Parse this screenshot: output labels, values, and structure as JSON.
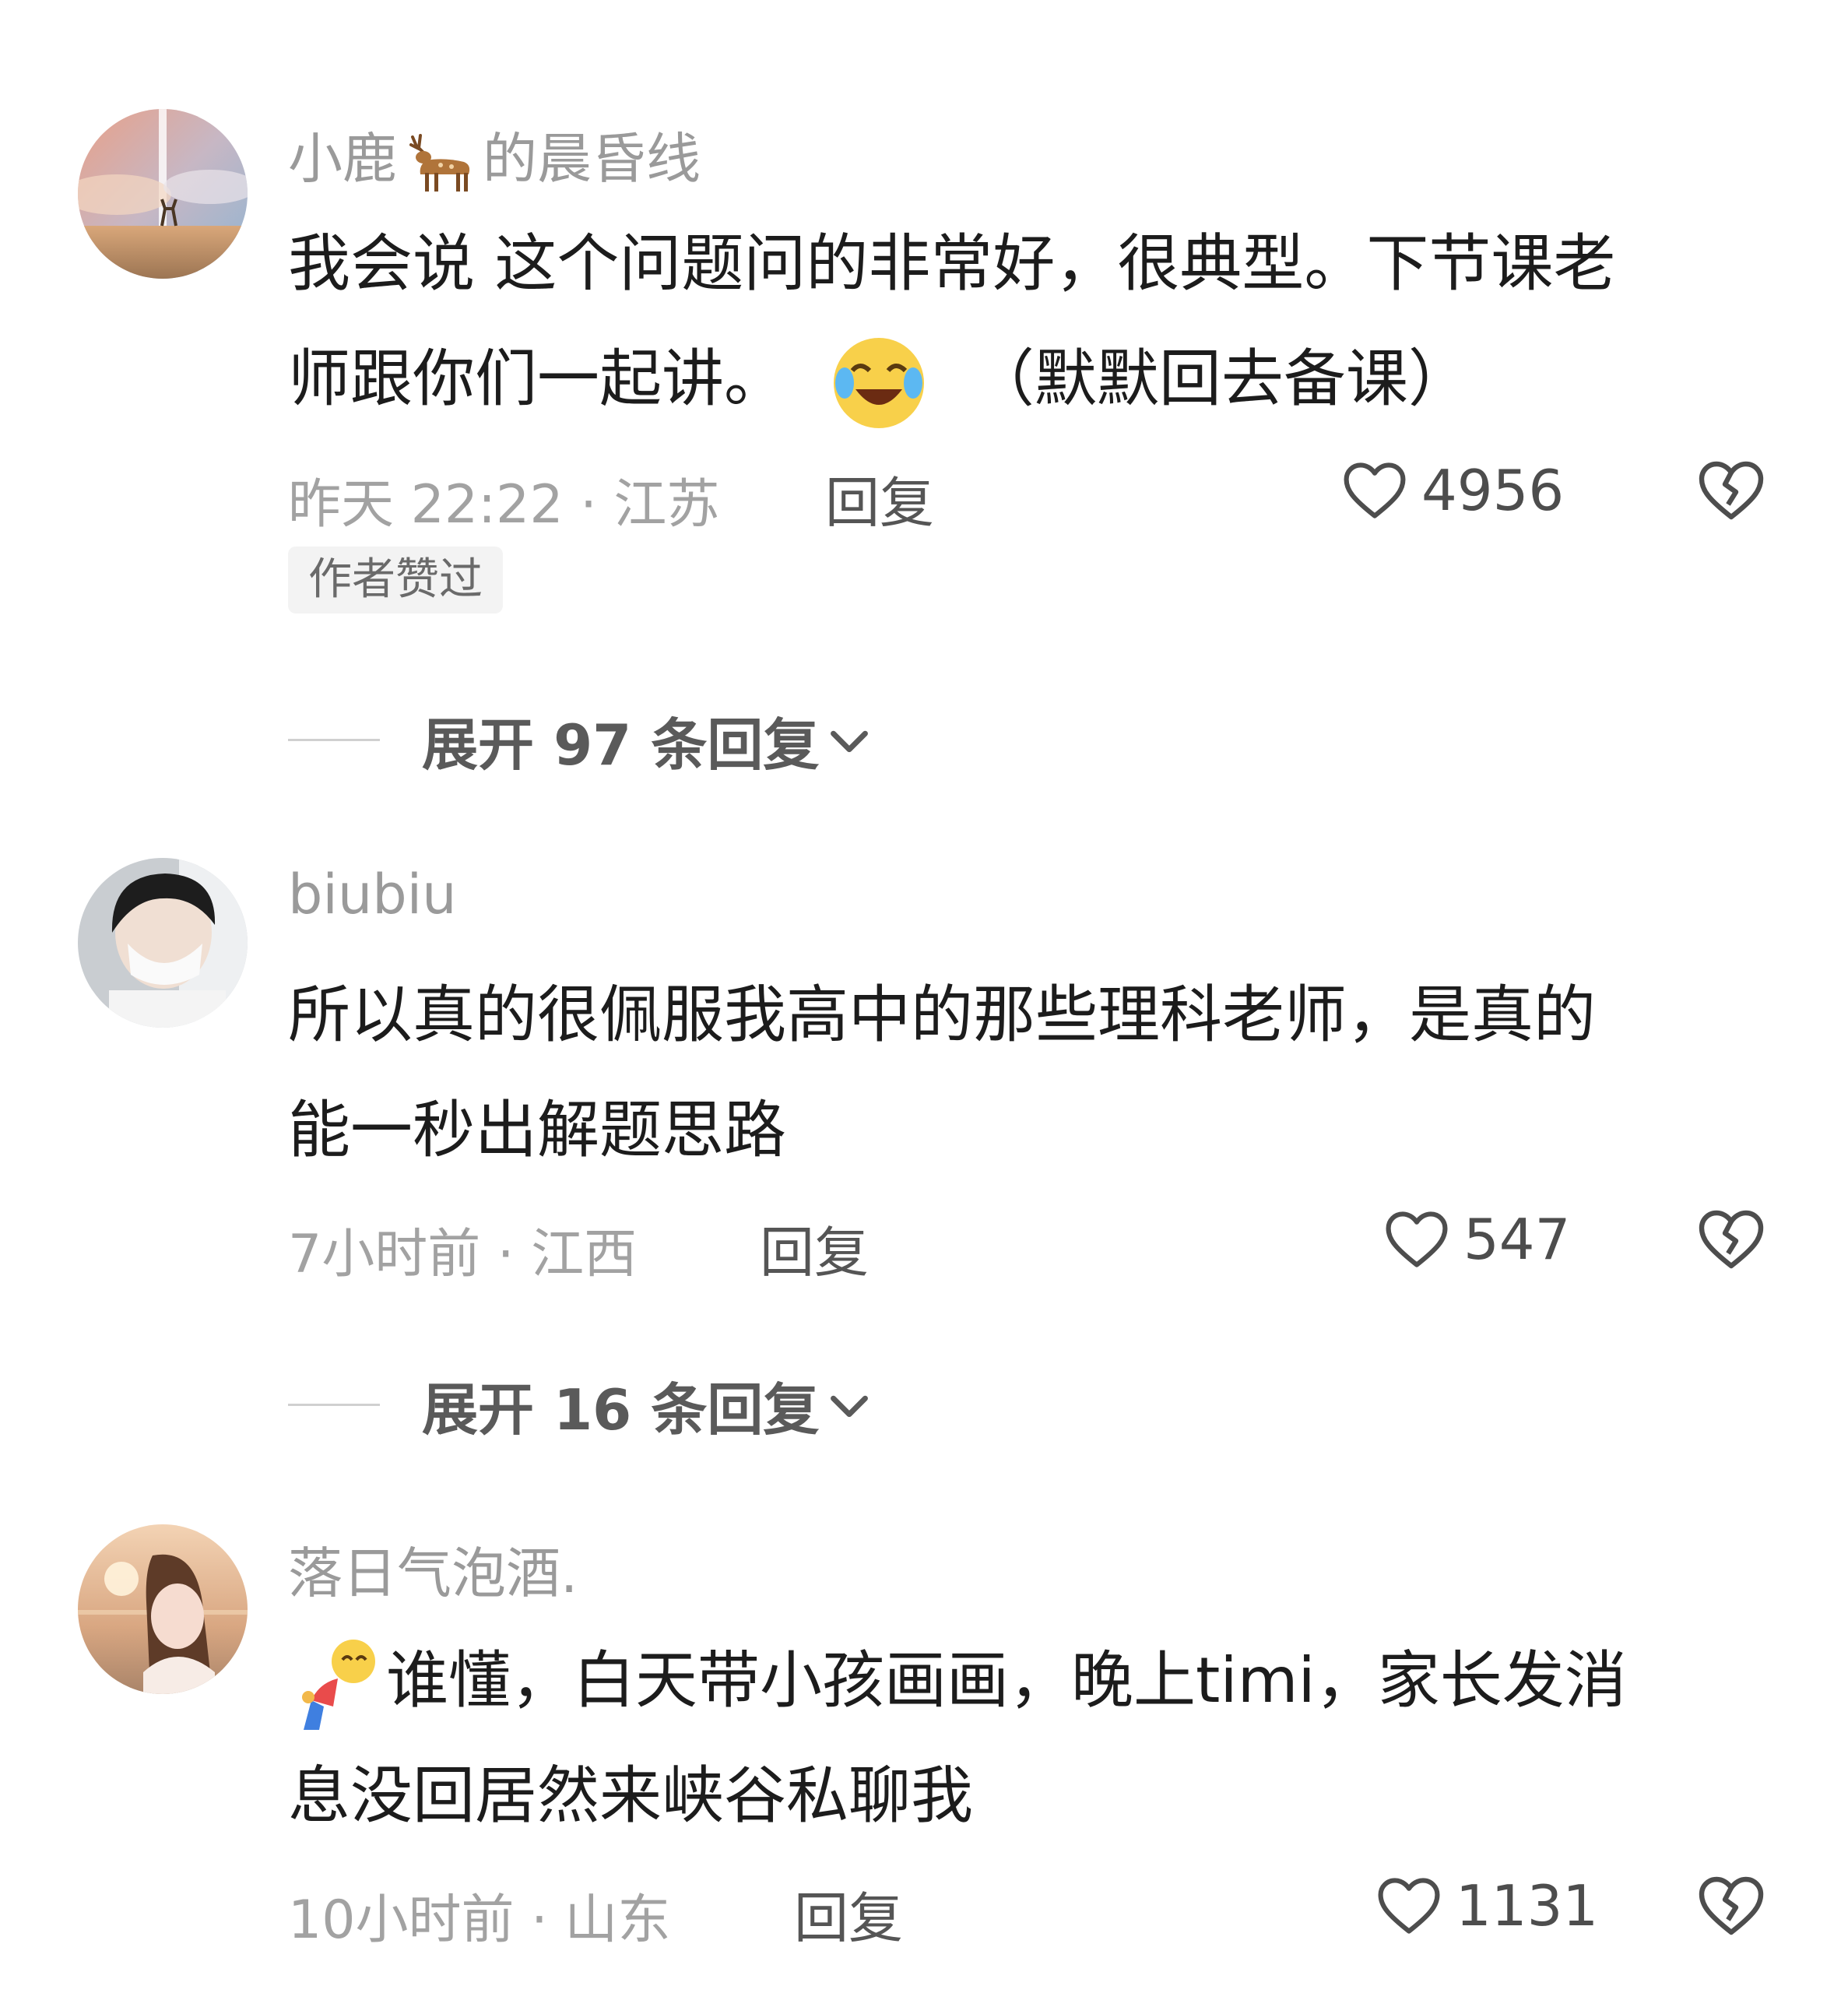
{
  "comments": [
    {
      "username_prefix": "小鹿",
      "username_suffix": "的晨昏线",
      "username_emoji": "deer-emoji",
      "line1": "我会说 这个问题问的非常好，很典型。下节课老",
      "line2a": "师跟你们一起讲。",
      "line2_emoji": "crying-laughing-emoji",
      "line2b": "（默默回去备课）",
      "meta": "昨天 22:22 · 江苏",
      "reply": "回复",
      "likes": "4956",
      "badge": "作者赞过",
      "expand": "展开 97 条回复"
    },
    {
      "username": "biubiu",
      "line1": "所以真的很佩服我高中的那些理科老师，是真的",
      "line2": "能一秒出解题思路",
      "meta": "7小时前 · 江西",
      "reply": "回复",
      "likes": "547",
      "expand": "展开 16 条回复"
    },
    {
      "username": "落日气泡酒.",
      "line1_emoji": "bowing-emoji",
      "line1": "谁懂，白天带小孩画画，晚上timi，家长发消",
      "line2": "息没回居然来峡谷私聊我",
      "meta": "10小时前 · 山东",
      "reply": "回复",
      "likes": "1131"
    }
  ],
  "icons": {
    "like": "heart-outline-icon",
    "dislike": "broken-heart-icon",
    "expand": "chevron-down-icon"
  },
  "colors": {
    "username": "#9a9a9a",
    "meta": "#a2a2a2",
    "text": "#1c1c1c"
  }
}
